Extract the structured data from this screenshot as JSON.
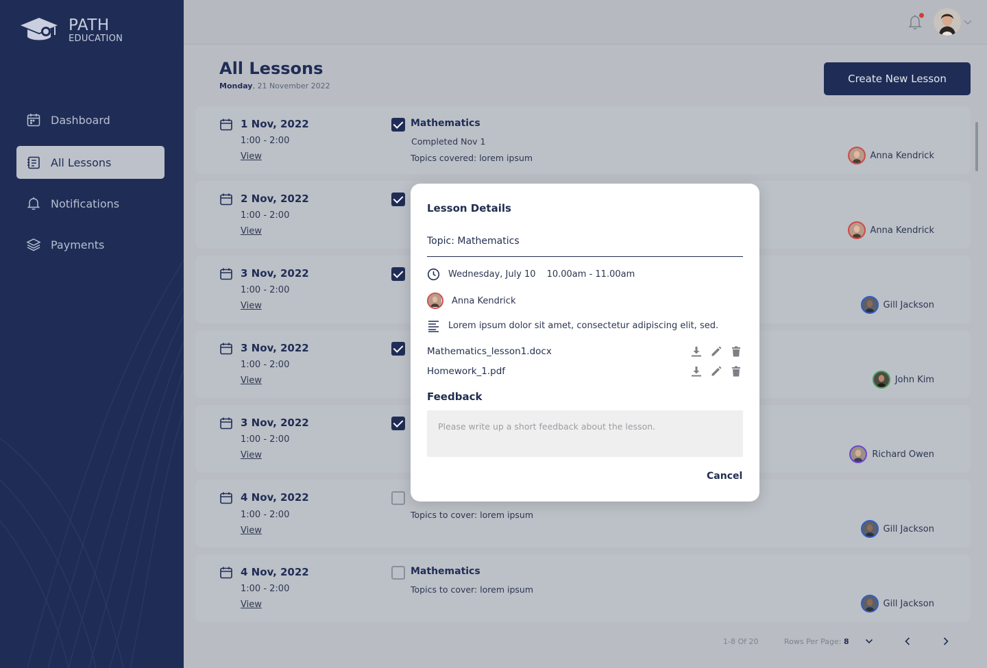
{
  "brand": {
    "name": "PATH",
    "sub": "EDUCATION"
  },
  "nav": [
    {
      "label": "Dashboard",
      "icon": "calendar-grid-icon"
    },
    {
      "label": "All Lessons",
      "icon": "notebook-icon",
      "active": true
    },
    {
      "label": "Notifications",
      "icon": "bell-icon"
    },
    {
      "label": "Payments",
      "icon": "layers-icon"
    }
  ],
  "header": {
    "title": "All Lessons",
    "date_day": "Monday",
    "date_rest": ", 21 November 2022",
    "create_button": "Create New Lesson"
  },
  "lessons": [
    {
      "date": "1 Nov, 2022",
      "time": "1:00 - 2:00",
      "view": "View",
      "checked": true,
      "subject": "Mathematics",
      "status": "Completed Nov 1",
      "topics": "Topics covered: lorem ipsum",
      "teacher": "Anna Kendrick",
      "ring": "red"
    },
    {
      "date": "2 Nov, 2022",
      "time": "1:00 - 2:00",
      "view": "View",
      "checked": true,
      "teacher": "Anna Kendrick",
      "ring": "red"
    },
    {
      "date": "3 Nov, 2022",
      "time": "1:00 - 2:00",
      "view": "View",
      "checked": true,
      "teacher": "Gill Jackson",
      "ring": "blue"
    },
    {
      "date": "3 Nov, 2022",
      "time": "1:00 - 2:00",
      "view": "View",
      "checked": true,
      "teacher": "John Kim",
      "ring": "green"
    },
    {
      "date": "3 Nov, 2022",
      "time": "1:00 - 2:00",
      "view": "View",
      "checked": true,
      "teacher": "Richard Owen",
      "ring": "purple"
    },
    {
      "date": "4 Nov, 2022",
      "time": "1:00 - 2:00",
      "view": "View",
      "checked": false,
      "topics": "Topics to cover: lorem ipsum",
      "teacher": "Gill Jackson",
      "ring": "blue"
    },
    {
      "date": "4 Nov, 2022",
      "time": "1:00 - 2:00",
      "view": "View",
      "checked": false,
      "subject": "Mathematics",
      "topics": "Topics to cover: lorem ipsum",
      "teacher": "Gill Jackson",
      "ring": "blue"
    }
  ],
  "pagination": {
    "range": "1-8 Of 20",
    "rows_label": "Rows Per Page: ",
    "rows_value": "8"
  },
  "modal": {
    "title": "Lesson Details",
    "topic_label": "Topic: ",
    "topic_value": "Mathematics",
    "date": "Wednesday, July 10",
    "time": "10.00am - 11.00am",
    "teacher": "Anna Kendrick",
    "description": "Lorem ipsum dolor sit amet, consectetur adipiscing elit, sed.",
    "files": [
      "Mathematics_lesson1.docx",
      "Homework_1.pdf"
    ],
    "feedback_title": "Feedback",
    "feedback_placeholder": "Please write up a short feedback about the lesson.",
    "cancel": "Cancel"
  }
}
